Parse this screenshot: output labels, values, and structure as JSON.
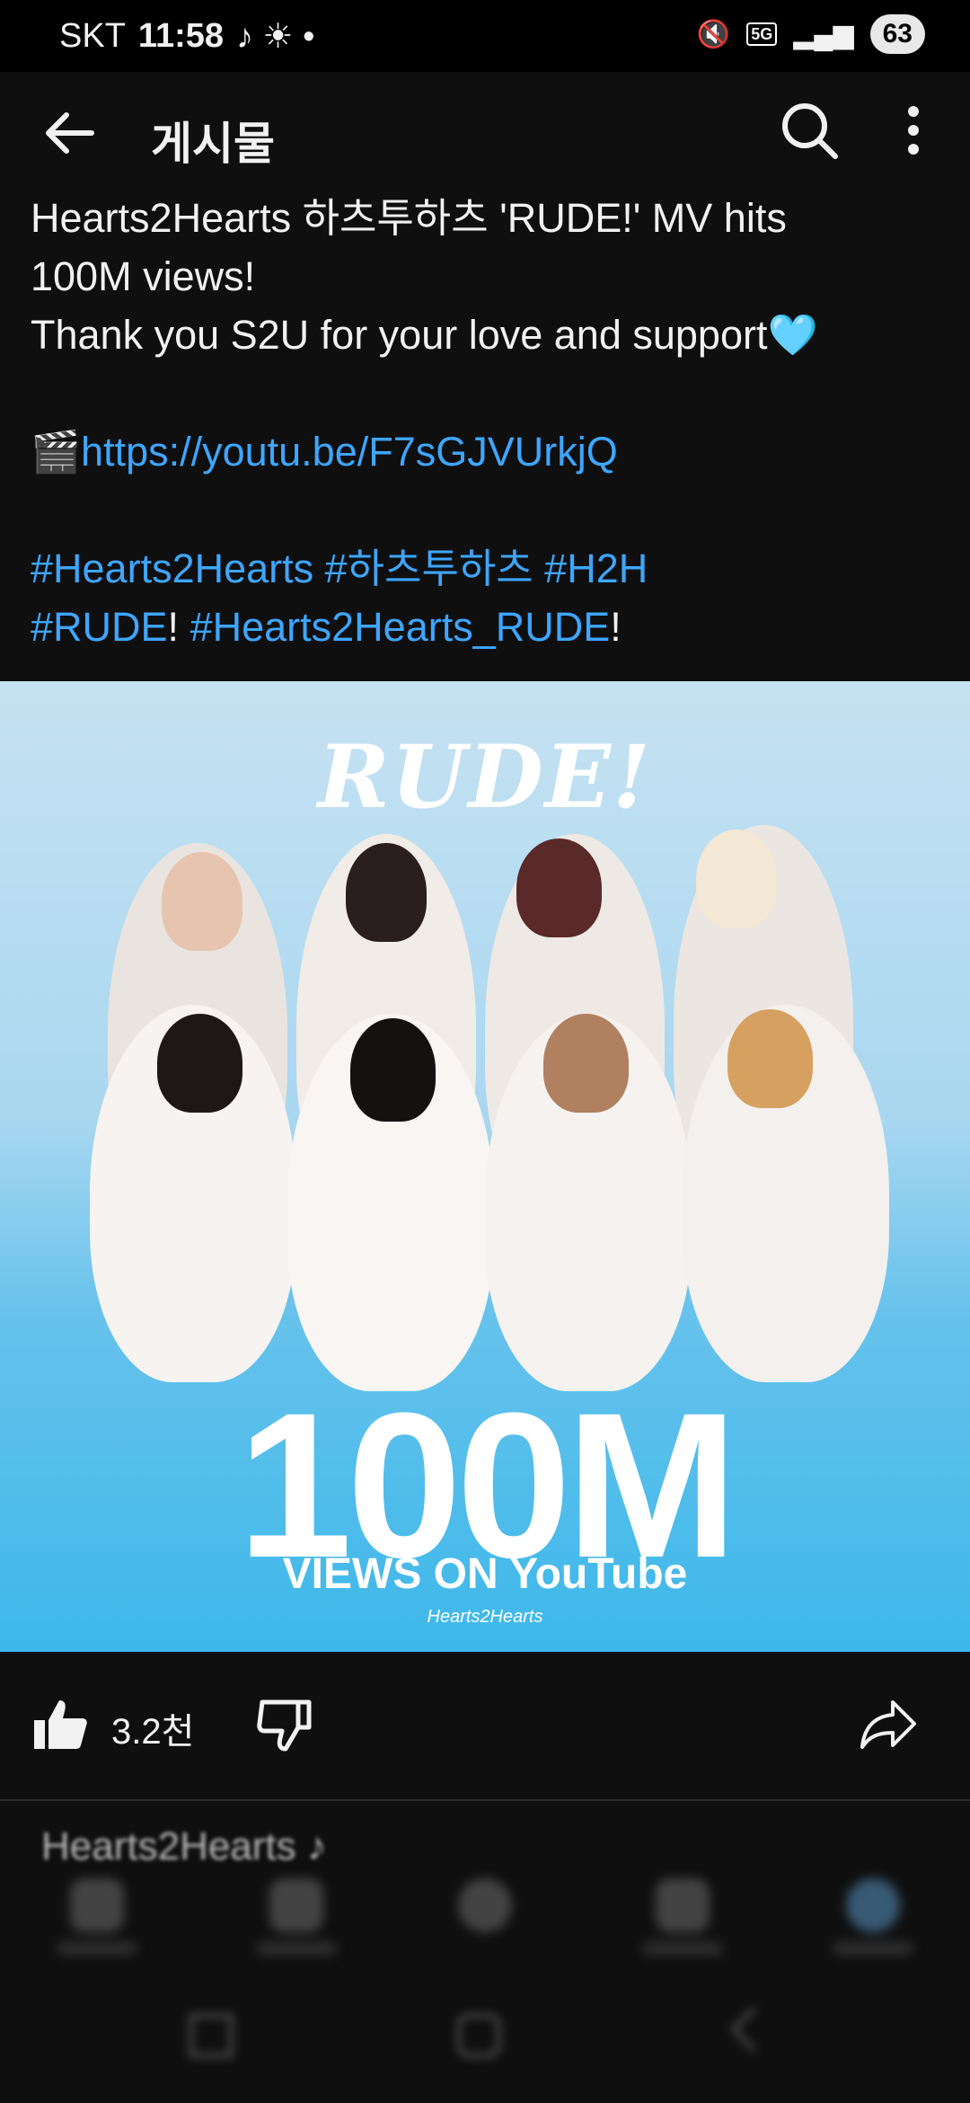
{
  "status_bar": {
    "carrier": "SKT",
    "time": "11:58",
    "network": "5G",
    "battery": "63"
  },
  "app_bar": {
    "title": "게시물"
  },
  "post": {
    "line1": "Hearts2Hearts 하츠투하츠 'RUDE!' MV hits",
    "line2": "100M views!",
    "line3": "Thank you S2U for your love and support",
    "line3_emoji": "🩵",
    "link_emoji": "🎬",
    "link": "https://youtu.be/F7sGJVUrkjQ",
    "hashtags_line1": "#Hearts2Hearts #하츠투하츠 #H2H",
    "hashtag_rude": "#RUDE",
    "bang1": "!",
    "hashtag_rude2": "#Hearts2Hearts_RUDE",
    "bang2": "!"
  },
  "image": {
    "logo": "RUDE!",
    "big_text": "100M",
    "sub_text": "VIEWS ON YouTube",
    "signature": "Hearts2Hearts"
  },
  "actions": {
    "like_count": "3.2천"
  },
  "next_preview": {
    "text": "Hearts2Hearts ♪"
  },
  "colors": {
    "background": "#0f0f0f",
    "link": "#3ea6ff",
    "image_blue": "#3db8ea"
  }
}
